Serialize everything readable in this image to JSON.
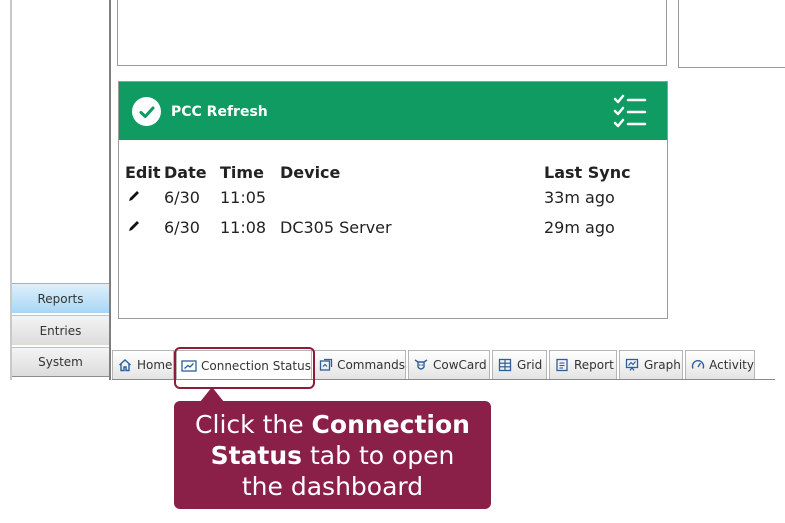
{
  "sidebar": {
    "items": [
      {
        "label": "Reports"
      },
      {
        "label": "Entries"
      },
      {
        "label": "System"
      }
    ]
  },
  "panel": {
    "title": "PCC Refresh",
    "header_color": "#0f9b61",
    "columns": {
      "edit": "Edit",
      "date": "Date",
      "time": "Time",
      "device": "Device",
      "last_sync": "Last Sync"
    },
    "rows": [
      {
        "date": "6/30",
        "time": "11:05",
        "device": "",
        "last_sync": "33m ago"
      },
      {
        "date": "6/30",
        "time": "11:08",
        "device": "DC305 Server",
        "last_sync": "29m ago"
      }
    ]
  },
  "tabs": [
    {
      "label": "Home",
      "icon": "home-icon"
    },
    {
      "label": "Connection Status",
      "icon": "connection-status-icon",
      "active": true
    },
    {
      "label": "Commands",
      "icon": "commands-icon"
    },
    {
      "label": "CowCard",
      "icon": "cow-icon"
    },
    {
      "label": "Grid",
      "icon": "grid-icon"
    },
    {
      "label": "Report",
      "icon": "report-icon"
    },
    {
      "label": "Graph",
      "icon": "graph-icon"
    },
    {
      "label": "Activity",
      "icon": "gauge-icon"
    }
  ],
  "callout": {
    "part1": "Click the ",
    "bold1": "Connection Status",
    "part2": " tab to open the dashboard",
    "color": "#8a1f47"
  }
}
